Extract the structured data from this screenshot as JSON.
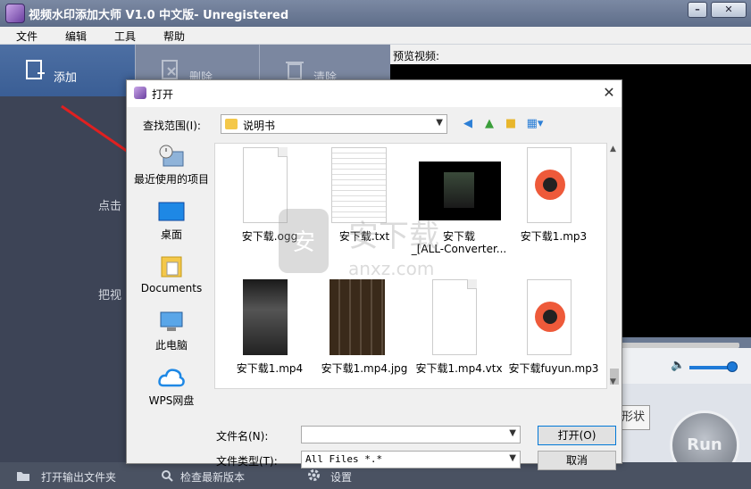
{
  "window": {
    "title": "视频水印添加大师 V1.0 中文版- Unregistered"
  },
  "menu": [
    "文件",
    "编辑",
    "工具",
    "帮助"
  ],
  "toolbar": {
    "add": "添加",
    "delete": "删除",
    "clear": "清除"
  },
  "left_hints": {
    "click_hint": "点击",
    "drag_hint": "把视"
  },
  "preview": {
    "label": "预览视频:"
  },
  "shape_label": "形状",
  "run_label": "Run",
  "statusbar": {
    "open_output": "打开输出文件夹",
    "check_update": "检查最新版本",
    "settings": "设置"
  },
  "dialog": {
    "title": "打开",
    "lookin_label": "查找范围(I):",
    "lookin_value": "说明书",
    "places": [
      "最近使用的项目",
      "桌面",
      "Documents",
      "此电脑",
      "WPS网盘"
    ],
    "files": [
      {
        "name": "安下载.ogg",
        "kind": "doc"
      },
      {
        "name": "安下载.txt",
        "kind": "txt"
      },
      {
        "name": "安下载",
        "name2": "_[ALL-Converter...",
        "kind": "film"
      },
      {
        "name": "安下载1.mp3",
        "kind": "disc"
      },
      {
        "name": "安下载1.mp4",
        "kind": "photo"
      },
      {
        "name": "安下载1.mp4.jpg",
        "kind": "grid"
      },
      {
        "name": "安下载1.mp4.vtx",
        "kind": "doc"
      },
      {
        "name": "安下载fuyun.mp3",
        "kind": "disc"
      }
    ],
    "filename_label": "文件名(N):",
    "filename_value": "",
    "filetype_label": "文件类型(T):",
    "filetype_value": "All Files *.*",
    "open_button": "打开(O)",
    "cancel_button": "取消",
    "watermark_text": "anxz.com"
  },
  "colors": {
    "accent": "#0078d7",
    "arrow": "#e02020"
  }
}
